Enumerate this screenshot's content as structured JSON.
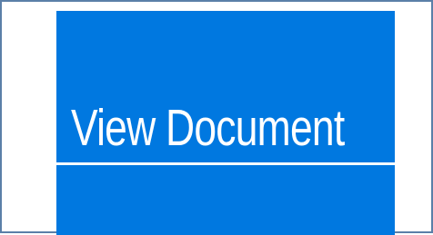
{
  "link": {
    "label": "View Document"
  },
  "colors": {
    "button_background": "#0078e0",
    "text": "#ffffff",
    "frame_border": "#5b7fa8"
  }
}
